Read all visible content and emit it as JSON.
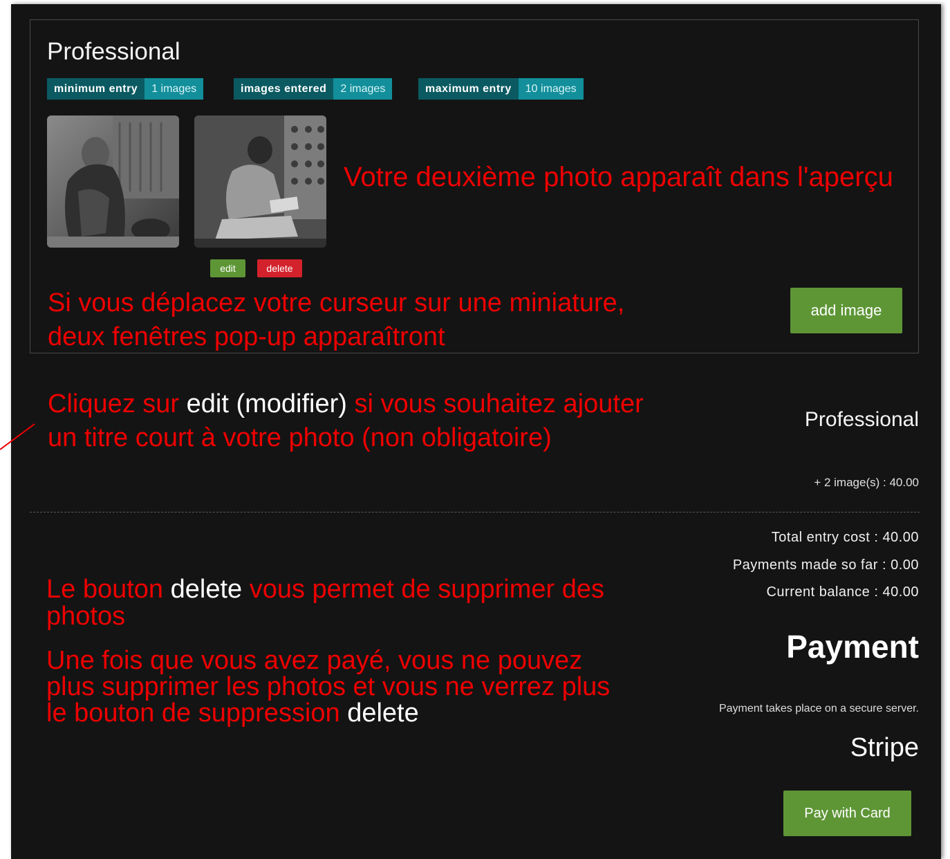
{
  "category": {
    "title": "Professional",
    "badges": [
      {
        "key": "minimum entry",
        "value": "1 images"
      },
      {
        "key": "images entered",
        "value": "2 images"
      },
      {
        "key": "maximum entry",
        "value": "10 images"
      }
    ],
    "thumbnails": [
      {
        "icon": "photo-elderly-woman"
      },
      {
        "icon": "photo-girl-writing"
      }
    ],
    "edit_label": "edit",
    "delete_label": "delete",
    "add_image_label": "add image"
  },
  "annotations": {
    "preview_note": "Votre deuxième photo apparaît dans l'aperçu",
    "hover_note_line1": "Si vous déplacez votre curseur sur une miniature,",
    "hover_note_line2": "deux fenêtres pop-up apparaîtront",
    "edit_note_part1": "Cliquez sur ",
    "edit_note_part2": "edit (modifier)",
    "edit_note_part3": " si vous souhaitez ajouter",
    "edit_note_line2": "un titre court à votre photo (non obligatoire)",
    "delete_note_part1": "Le bouton ",
    "delete_note_part2": "delete",
    "delete_note_part3": " vous permet de supprimer des",
    "delete_note_line2": "photos",
    "paid_note_line1": "Une fois que vous avez payé, vous ne pouvez",
    "paid_note_line2": "plus supprimer les photos et vous ne verrez plus",
    "paid_note_line3_part1": "le bouton de suppression ",
    "paid_note_line3_part2": "delete"
  },
  "summary": {
    "title": "Professional",
    "line": "+ 2 image(s) : 40.00",
    "total_entry_cost": "Total entry cost : 40.00",
    "payments_made": "Payments made so far : 0.00",
    "current_balance": "Current balance : 40.00"
  },
  "payment": {
    "heading": "Payment",
    "note": "Payment takes place on a secure server.",
    "provider": "Stripe",
    "pay_label": "Pay with Card"
  },
  "colors": {
    "background": "#141414",
    "annotation_red": "#ee0000",
    "button_green": "#5e9636",
    "badge_dark": "#0b5a62",
    "badge_light": "#128f9b",
    "delete_red": "#d3222c"
  }
}
